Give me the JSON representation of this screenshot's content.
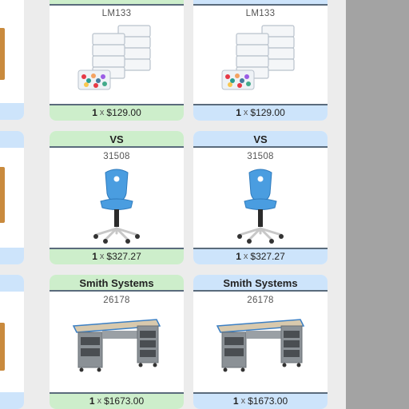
{
  "palette": {
    "green_band": "#cdeecb",
    "blue_band": "#cde4fb",
    "divider": "#5a6b7c",
    "background": "#ececec",
    "side_panel": "#a3a3a3"
  },
  "rows": [
    {
      "brand": "",
      "code": "LM133",
      "image_icon": "clear-storage-bins-icon",
      "quantity": "1",
      "times": "x",
      "price": "$129.00"
    },
    {
      "brand": "VS",
      "code": "31508",
      "image_icon": "blue-task-chair-icon",
      "quantity": "1",
      "times": "x",
      "price": "$327.27"
    },
    {
      "brand": "Smith Systems",
      "code": "26178",
      "image_icon": "storage-desk-icon",
      "quantity": "1",
      "times": "x",
      "price": "$1673.00"
    }
  ]
}
